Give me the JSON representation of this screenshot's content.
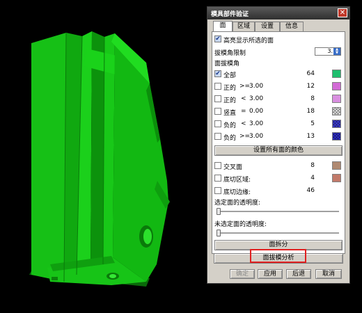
{
  "dialog": {
    "title": "模具部件验证",
    "close_glyph": "✕",
    "tabs": [
      {
        "label": "面",
        "active": true
      },
      {
        "label": "区域",
        "active": false
      },
      {
        "label": "设置",
        "active": false
      },
      {
        "label": "信息",
        "active": false
      }
    ],
    "highlight_label": "高亮显示所选的面",
    "draft_limit_label": "拔模角限制",
    "draft_limit_value": "3.",
    "draft_angle_label": "面拔模角",
    "rows": [
      {
        "label": "全部",
        "op": "",
        "value": "",
        "count": "64",
        "color": "#1fbf6f",
        "checked": true
      },
      {
        "label": "正的",
        "op": ">=",
        "value": "3.00",
        "count": "12",
        "color": "#d36bd6",
        "checked": false
      },
      {
        "label": "正的",
        "op": "<",
        "value": "3.00",
        "count": "8",
        "color": "#d98fe0",
        "checked": false
      },
      {
        "label": "竖直",
        "op": "=",
        "value": "0.00",
        "count": "18",
        "color": "#e8e8e8",
        "checked": false
      },
      {
        "label": "负的",
        "op": "<",
        "value": "3.00",
        "count": "5",
        "color": "#3d3dd8",
        "checked": false
      },
      {
        "label": "负的",
        "op": ">=",
        "value": "3.00",
        "count": "13",
        "color": "#2f2fd0",
        "checked": false
      }
    ],
    "set_all_color_label": "设置所有面的颜色",
    "extra_rows": [
      {
        "label": "交叉面",
        "count": "8",
        "color": "#b08a72",
        "checked": false
      },
      {
        "label": "底切区域:",
        "count": "4",
        "color": "#c27a6a",
        "checked": false
      },
      {
        "label": "底切边缘:",
        "count": "46",
        "color": "",
        "checked": false
      }
    ],
    "selected_transparency_label": "选定面的透明度:",
    "unselected_transparency_label": "未选定面的透明度:",
    "face_split_label": "面拆分",
    "face_draft_analysis_label": "面拔模分析",
    "buttons": {
      "ok": "确定",
      "apply": "应用",
      "back": "后退",
      "cancel": "取消"
    }
  },
  "colors": {
    "model_green": "#12c812",
    "model_dark": "#0a8a0a",
    "highlight_red": "#e02020"
  }
}
